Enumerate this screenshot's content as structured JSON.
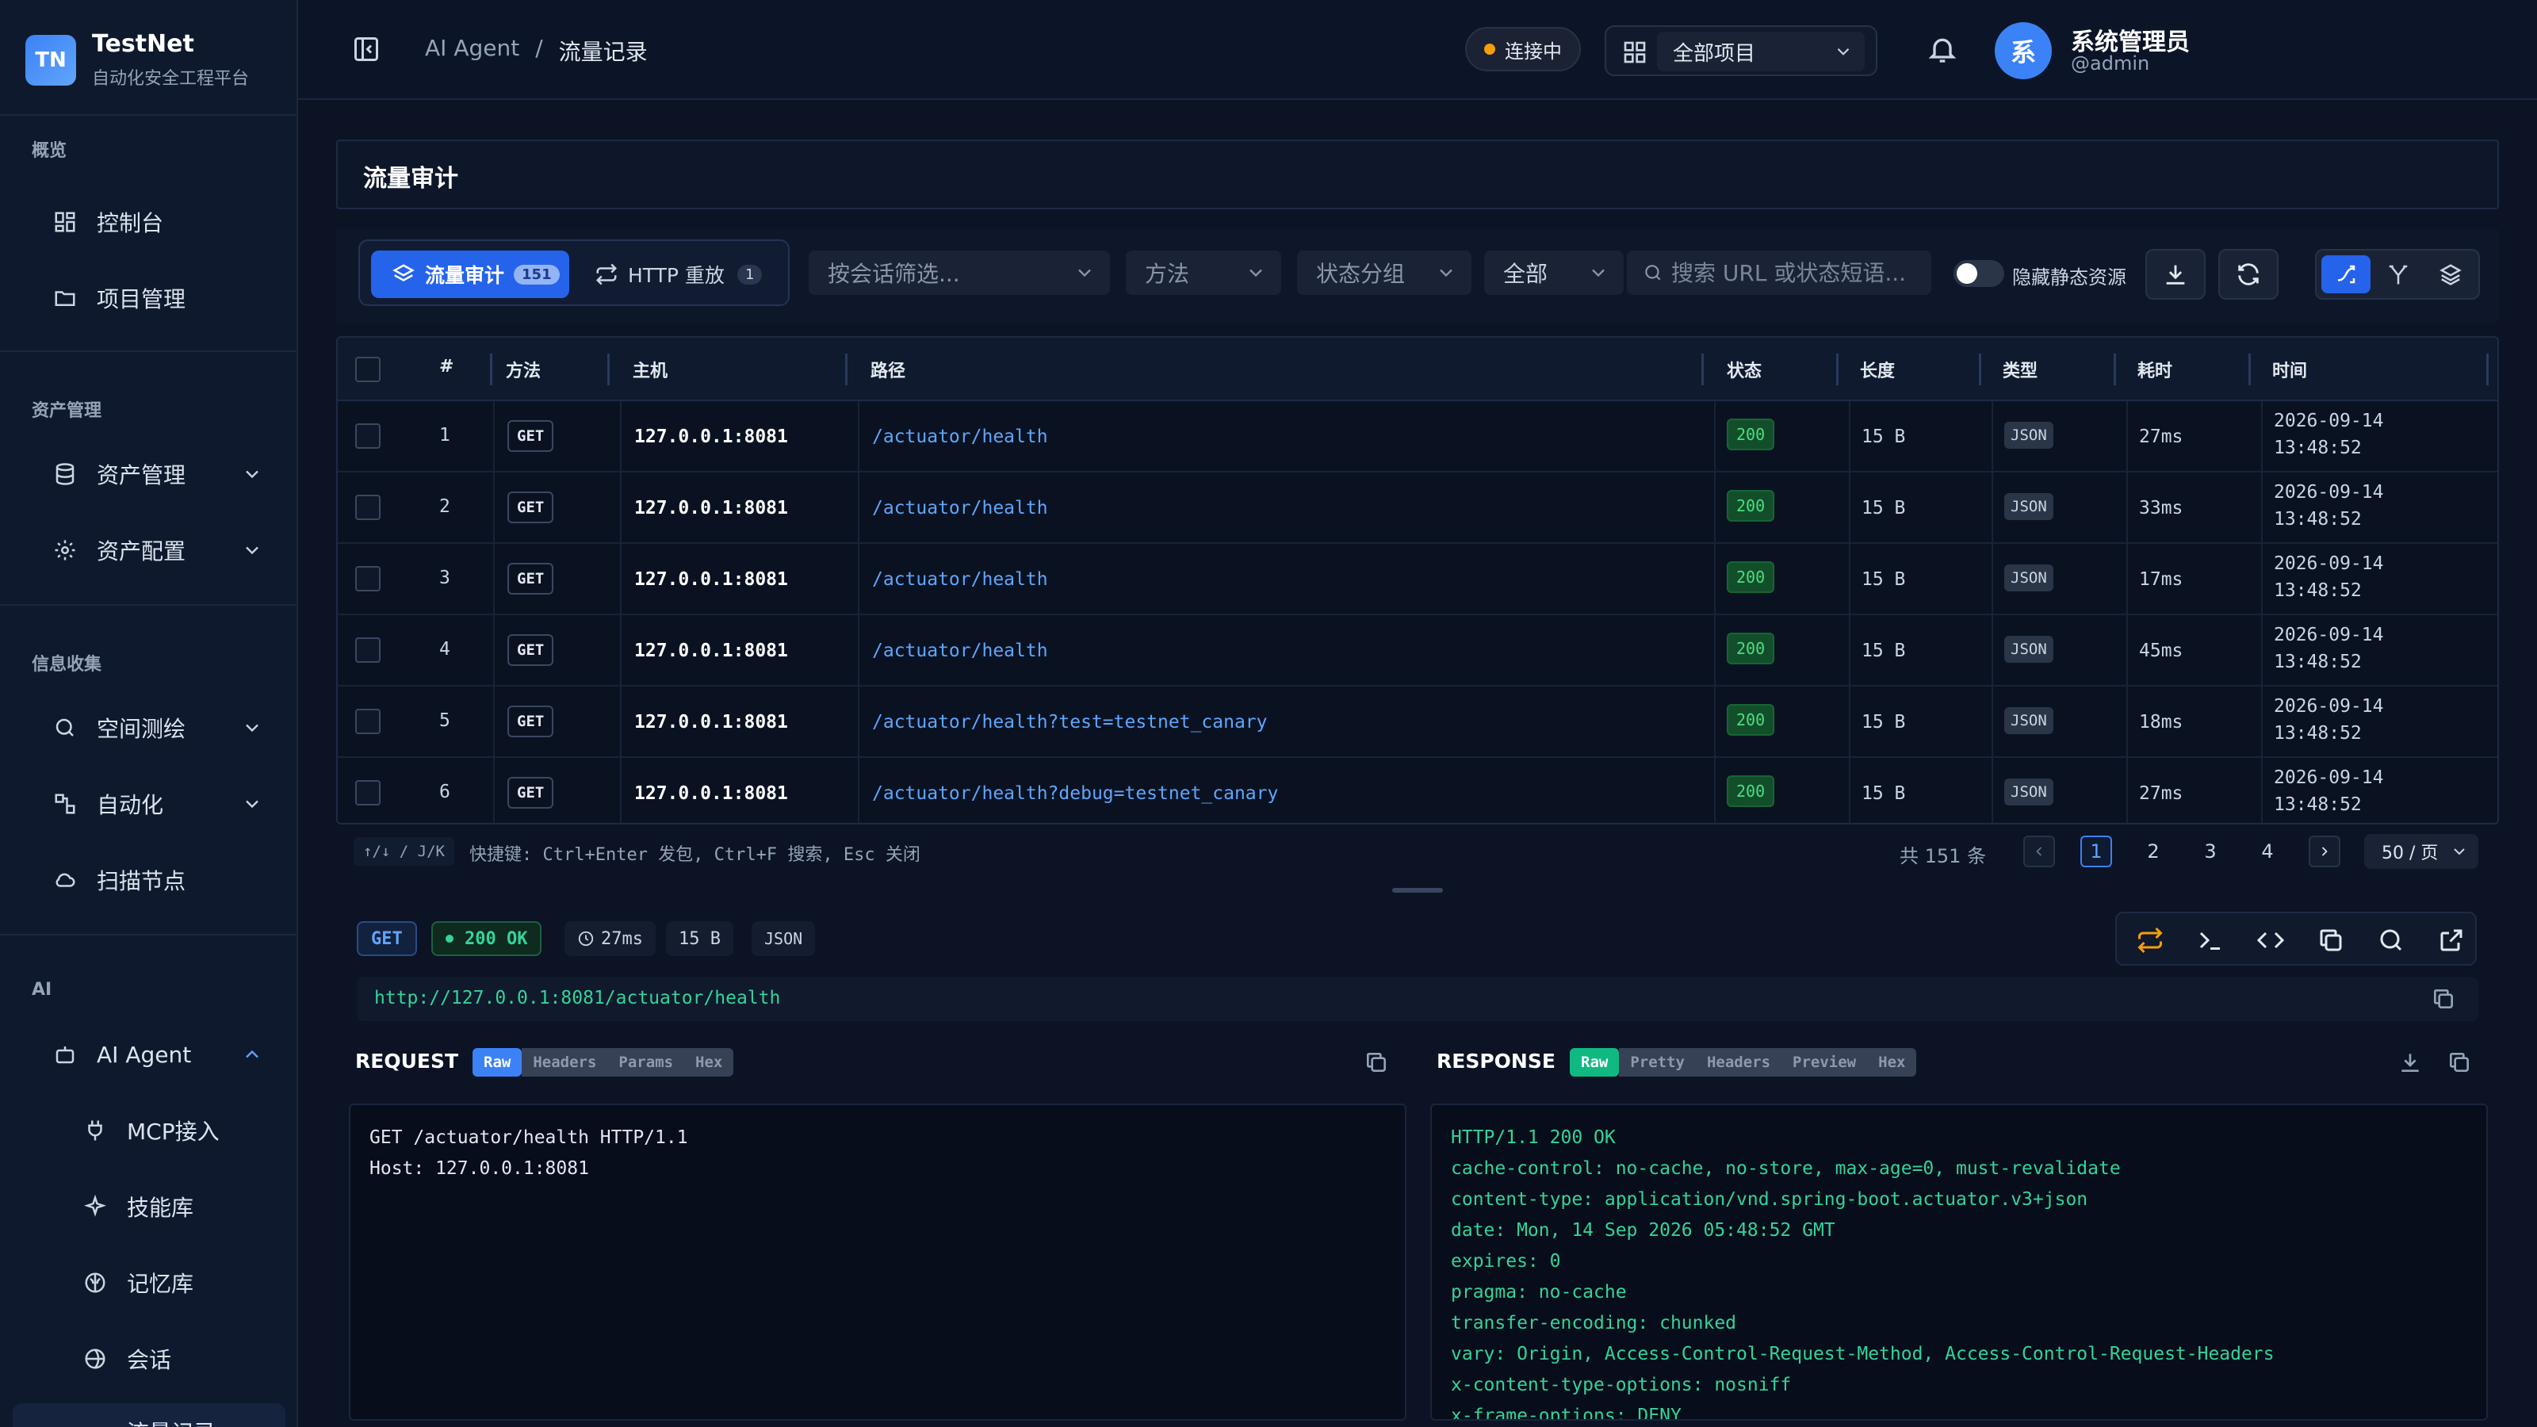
{
  "brand": {
    "logo": "TN",
    "name": "TestNet",
    "subtitle": "自动化安全工程平台"
  },
  "sidebar": {
    "sections": [
      "概览",
      "资产管理",
      "信息收集",
      "AI"
    ],
    "items": [
      {
        "label": "控制台",
        "icon": "dashboard-icon"
      },
      {
        "label": "项目管理",
        "icon": "folder-icon"
      },
      {
        "label": "资产管理",
        "icon": "database-icon"
      },
      {
        "label": "资产配置",
        "icon": "gear-icon"
      },
      {
        "label": "空间测绘",
        "icon": "search-icon"
      },
      {
        "label": "自动化",
        "icon": "workflow-icon"
      },
      {
        "label": "扫描节点",
        "icon": "cloud-icon"
      },
      {
        "label": "AI Agent",
        "icon": "robot-icon"
      },
      {
        "label": "MCP接入",
        "icon": "plug-icon"
      },
      {
        "label": "技能库",
        "icon": "sparkle-icon"
      },
      {
        "label": "记忆库",
        "icon": "brain-icon"
      },
      {
        "label": "会话",
        "icon": "chat-icon"
      },
      {
        "label": "流量记录",
        "icon": "traffic-icon"
      }
    ]
  },
  "header": {
    "breadcrumb": [
      "AI Agent",
      "/",
      "流量记录"
    ],
    "connection": "连接中",
    "project": "全部项目",
    "user": {
      "avatar": "系",
      "name": "系统管理员",
      "handle": "@admin"
    }
  },
  "page": {
    "title": "流量审计"
  },
  "toolbar": {
    "tabs": [
      {
        "label": "流量审计",
        "count": "151"
      },
      {
        "label": "HTTP 重放",
        "count": "1"
      }
    ],
    "session_filter": "按会话筛选...",
    "method_filter": "方法",
    "status_filter": "状态分组",
    "scope_filter": "全部",
    "search_placeholder": "搜索 URL 或状态短语...",
    "hide_static": "隐藏静态资源"
  },
  "table": {
    "headers": [
      "#",
      "方法",
      "主机",
      "路径",
      "状态",
      "长度",
      "类型",
      "耗时",
      "时间"
    ],
    "rows": [
      {
        "n": "1",
        "method": "GET",
        "host": "127.0.0.1:8081",
        "path": "/actuator/health",
        "status": "200",
        "len": "15 B",
        "type": "JSON",
        "time": "27ms",
        "date": "2026-09-14",
        "clock": "13:48:52"
      },
      {
        "n": "2",
        "method": "GET",
        "host": "127.0.0.1:8081",
        "path": "/actuator/health",
        "status": "200",
        "len": "15 B",
        "type": "JSON",
        "time": "33ms",
        "date": "2026-09-14",
        "clock": "13:48:52"
      },
      {
        "n": "3",
        "method": "GET",
        "host": "127.0.0.1:8081",
        "path": "/actuator/health",
        "status": "200",
        "len": "15 B",
        "type": "JSON",
        "time": "17ms",
        "date": "2026-09-14",
        "clock": "13:48:52"
      },
      {
        "n": "4",
        "method": "GET",
        "host": "127.0.0.1:8081",
        "path": "/actuator/health",
        "status": "200",
        "len": "15 B",
        "type": "JSON",
        "time": "45ms",
        "date": "2026-09-14",
        "clock": "13:48:52"
      },
      {
        "n": "5",
        "method": "GET",
        "host": "127.0.0.1:8081",
        "path": "/actuator/health?test=testnet_canary",
        "status": "200",
        "len": "15 B",
        "type": "JSON",
        "time": "18ms",
        "date": "2026-09-14",
        "clock": "13:48:52"
      },
      {
        "n": "6",
        "method": "GET",
        "host": "127.0.0.1:8081",
        "path": "/actuator/health?debug=testnet_canary",
        "status": "200",
        "len": "15 B",
        "type": "JSON",
        "time": "27ms",
        "date": "2026-09-14",
        "clock": "13:48:52"
      }
    ]
  },
  "footer": {
    "kbd": "↑/↓ / J/K",
    "hint": "快捷键: Ctrl+Enter 发包, Ctrl+F 搜索, Esc 关闭",
    "total": "共 151 条",
    "pages": [
      "1",
      "2",
      "3",
      "4"
    ],
    "page_size": "50 / 页"
  },
  "detail": {
    "method": "GET",
    "status": "200 OK",
    "time": "27ms",
    "size": "15 B",
    "type": "JSON",
    "url": "http://127.0.0.1:8081/actuator/health",
    "request": {
      "title": "REQUEST",
      "tabs": [
        "Raw",
        "Headers",
        "Params",
        "Hex"
      ],
      "body": "GET /actuator/health HTTP/1.1\nHost: 127.0.0.1:8081"
    },
    "response": {
      "title": "RESPONSE",
      "tabs": [
        "Raw",
        "Pretty",
        "Headers",
        "Preview",
        "Hex"
      ],
      "body": "HTTP/1.1 200 OK\ncache-control: no-cache, no-store, max-age=0, must-revalidate\ncontent-type: application/vnd.spring-boot.actuator.v3+json\ndate: Mon, 14 Sep 2026 05:48:52 GMT\nexpires: 0\npragma: no-cache\ntransfer-encoding: chunked\nvary: Origin, Access-Control-Request-Method, Access-Control-Request-Headers\nx-content-type-options: nosniff\nx-frame-options: DENY"
    }
  },
  "colors": {
    "accent": "#2563eb",
    "success": "#34d399",
    "link": "#60a5fa",
    "warning": "#f59e0b"
  }
}
